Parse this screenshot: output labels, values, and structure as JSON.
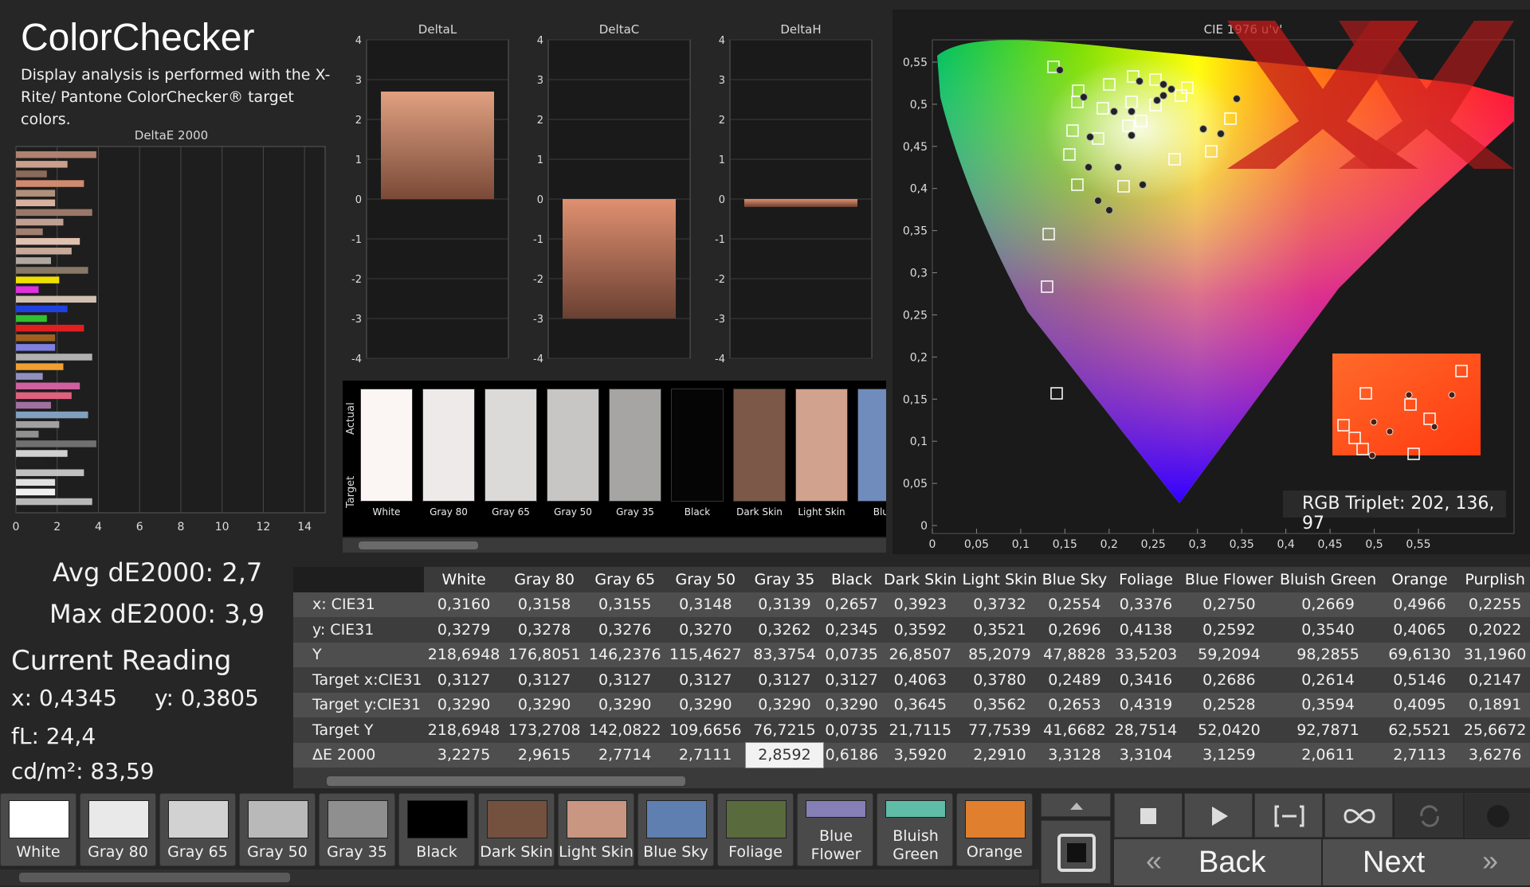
{
  "header": {
    "title": "ColorChecker",
    "subtitle": "Display analysis is performed with the X-Rite/ Pantone ColorChecker® target colors."
  },
  "deltae_chart": {
    "title": "DeltaE 2000",
    "ticks": [
      "0",
      "2",
      "4",
      "6",
      "8",
      "10",
      "12",
      "14"
    ]
  },
  "delta_charts": [
    {
      "title": "DeltaL",
      "ticks": [
        "4",
        "3",
        "2",
        "1",
        "0",
        "-1",
        "-2",
        "-3",
        "-4"
      ],
      "value": 2.7
    },
    {
      "title": "DeltaC",
      "ticks": [
        "4",
        "3",
        "2",
        "1",
        "0",
        "-1",
        "-2",
        "-3",
        "-4"
      ],
      "value": -3.0
    },
    {
      "title": "DeltaH",
      "ticks": [
        "4",
        "3",
        "2",
        "1",
        "0",
        "-1",
        "-2",
        "-3",
        "-4"
      ],
      "value": -0.2
    }
  ],
  "swatches": {
    "actual_label": "Actual",
    "target_label": "Target",
    "items": [
      {
        "name": "White",
        "color": "#fbf5f3"
      },
      {
        "name": "Gray 80",
        "color": "#eeeae9"
      },
      {
        "name": "Gray 65",
        "color": "#dcdad9"
      },
      {
        "name": "Gray 50",
        "color": "#c8c6c5"
      },
      {
        "name": "Gray 35",
        "color": "#a6a5a4"
      },
      {
        "name": "Black",
        "color": "#050505"
      },
      {
        "name": "Dark Skin",
        "color": "#7b5847"
      },
      {
        "name": "Light Skin",
        "color": "#d1a28e"
      },
      {
        "name": "Blue",
        "color": "#6f8cbc"
      }
    ]
  },
  "stats": {
    "avg": "Avg dE2000: 2,7",
    "max": "Max dE2000: 3,9",
    "current_reading": "Current Reading",
    "x": "x: 0,4345",
    "y": "y: 0,3805",
    "fl": "fL: 24,4",
    "cd": "cd/m²: 83,59"
  },
  "cie": {
    "title": "CIE 1976 u'v'",
    "rgb_triplet": "RGB Triplet: 202, 136, 97",
    "y_ticks": [
      "0,55",
      "0,5",
      "0,45",
      "0,4",
      "0,35",
      "0,3",
      "0,25",
      "0,2",
      "0,15",
      "0,1",
      "0,05",
      "0"
    ],
    "x_ticks": [
      "0",
      "0,05",
      "0,1",
      "0,15",
      "0,2",
      "0,25",
      "0,3",
      "0,35",
      "0,4",
      "0,45",
      "0,5",
      "0,55"
    ]
  },
  "table": {
    "columns": [
      "White",
      "Gray 80",
      "Gray 65",
      "Gray 50",
      "Gray 35",
      "Black",
      "Dark Skin",
      "Light Skin",
      "Blue Sky",
      "Foliage",
      "Blue Flower",
      "Bluish Green",
      "Orange",
      "Purplish"
    ],
    "rows": [
      {
        "label": "x: CIE31",
        "values": [
          "0,3160",
          "0,3158",
          "0,3155",
          "0,3148",
          "0,3139",
          "0,2657",
          "0,3923",
          "0,3732",
          "0,2554",
          "0,3376",
          "0,2750",
          "0,2669",
          "0,4966",
          "0,2255"
        ]
      },
      {
        "label": "y: CIE31",
        "values": [
          "0,3279",
          "0,3278",
          "0,3276",
          "0,3270",
          "0,3262",
          "0,2345",
          "0,3592",
          "0,3521",
          "0,2696",
          "0,4138",
          "0,2592",
          "0,3540",
          "0,4065",
          "0,2022"
        ]
      },
      {
        "label": "Y",
        "values": [
          "218,6948",
          "176,8051",
          "146,2376",
          "115,4627",
          "83,3754",
          "0,0735",
          "26,8507",
          "85,2079",
          "47,8828",
          "33,5203",
          "59,2094",
          "98,2855",
          "69,6130",
          "31,1960"
        ]
      },
      {
        "label": "Target x:CIE31",
        "values": [
          "0,3127",
          "0,3127",
          "0,3127",
          "0,3127",
          "0,3127",
          "0,3127",
          "0,4063",
          "0,3780",
          "0,2489",
          "0,3416",
          "0,2686",
          "0,2614",
          "0,5146",
          "0,2147"
        ]
      },
      {
        "label": "Target y:CIE31",
        "values": [
          "0,3290",
          "0,3290",
          "0,3290",
          "0,3290",
          "0,3290",
          "0,3290",
          "0,3645",
          "0,3562",
          "0,2653",
          "0,4319",
          "0,2528",
          "0,3594",
          "0,4095",
          "0,1891"
        ]
      },
      {
        "label": "Target Y",
        "values": [
          "218,6948",
          "173,2708",
          "142,0822",
          "109,6656",
          "76,7215",
          "0,0735",
          "21,7115",
          "77,7539",
          "41,6682",
          "28,7514",
          "52,0420",
          "92,7871",
          "62,5521",
          "25,6672"
        ]
      },
      {
        "label": "ΔE 2000",
        "values": [
          "3,2275",
          "2,9615",
          "2,7714",
          "2,7111",
          "2,8592",
          "0,6186",
          "3,5920",
          "2,2910",
          "3,3128",
          "3,3104",
          "3,1259",
          "2,0611",
          "2,7113",
          "3,6276"
        ]
      }
    ]
  },
  "color_buttons": [
    {
      "label": "White",
      "color": "#ffffff"
    },
    {
      "label": "Gray 80",
      "color": "#e9e9e9"
    },
    {
      "label": "Gray 65",
      "color": "#d2d2d2"
    },
    {
      "label": "Gray 50",
      "color": "#b9b9b9"
    },
    {
      "label": "Gray 35",
      "color": "#8f8f8f"
    },
    {
      "label": "Black",
      "color": "#000000"
    },
    {
      "label": "Dark Skin",
      "color": "#74503f"
    },
    {
      "label": "Light Skin",
      "color": "#c99682"
    },
    {
      "label": "Blue Sky",
      "color": "#5f7fb1"
    },
    {
      "label": "Foliage",
      "color": "#596b3c"
    },
    {
      "label": "Blue Flower",
      "color": "#8480b5"
    },
    {
      "label": "Bluish Green",
      "color": "#5fbca7"
    },
    {
      "label": "Orange",
      "color": "#e07f2d"
    }
  ],
  "nav": {
    "back": "Back",
    "next": "Next"
  }
}
